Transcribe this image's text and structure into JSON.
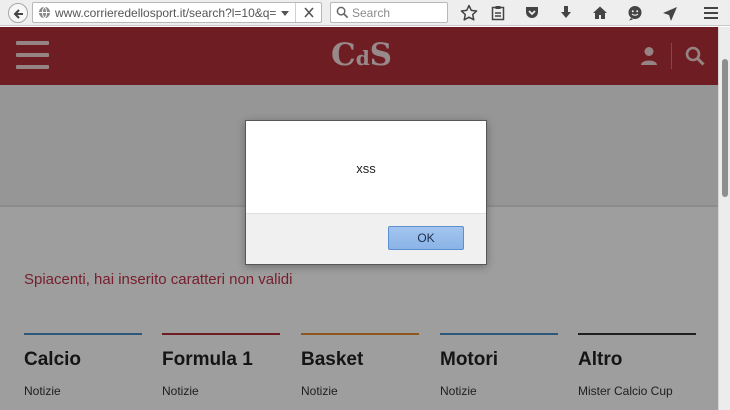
{
  "browser": {
    "url": "www.corrieredellosport.it/search?l=10&q=",
    "search_placeholder": "Search"
  },
  "site": {
    "logo_big_c": "C",
    "logo_small_d": "d",
    "logo_big_s": "S",
    "brand_color": "#b22f37"
  },
  "main": {
    "error_message": "Spiacenti, hai inserito caratteri non validi",
    "categories": [
      {
        "title": "Calcio",
        "sub": "Notizie",
        "bar_color": "#4a8fc4"
      },
      {
        "title": "Formula 1",
        "sub": "Notizie",
        "bar_color": "#b22f37"
      },
      {
        "title": "Basket",
        "sub": "Notizie",
        "bar_color": "#e38c2f"
      },
      {
        "title": "Motori",
        "sub": "Notizie",
        "bar_color": "#4a8fc4"
      },
      {
        "title": "Altro",
        "sub": "Mister Calcio Cup",
        "bar_color": "#333333"
      }
    ]
  },
  "alert": {
    "message": "xss",
    "ok_label": "OK"
  }
}
